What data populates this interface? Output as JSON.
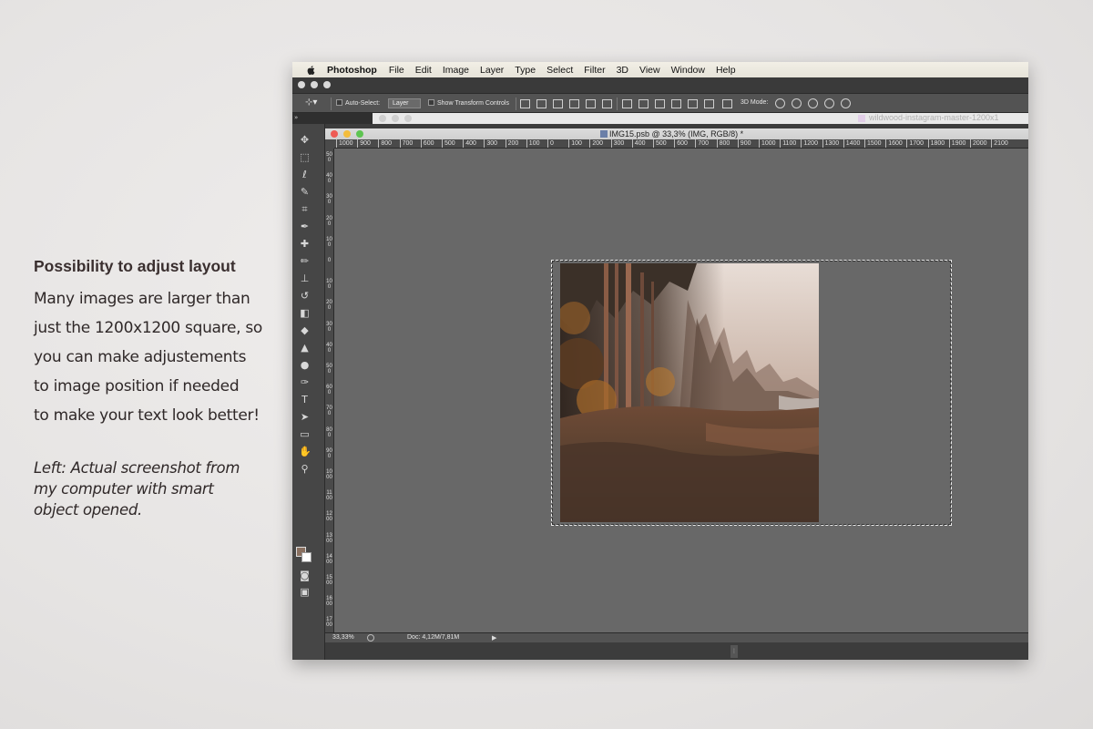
{
  "copy": {
    "heading": "Possibility to adjust layout",
    "paragraph": [
      "Many images are larger than",
      "just the 1200x1200 square, so",
      "you can make adjustements",
      "to image position if needed",
      "to make your text look better!"
    ],
    "note": [
      "Left: Actual screenshot from",
      "my computer with smart",
      "object opened."
    ]
  },
  "menubar": {
    "app_name": "Photoshop",
    "items": [
      "File",
      "Edit",
      "Image",
      "Layer",
      "Type",
      "Select",
      "Filter",
      "3D",
      "View",
      "Window",
      "Help"
    ]
  },
  "options_bar": {
    "auto_select_label": "Auto-Select:",
    "auto_select_value": "Layer",
    "transform_label": "Show Transform Controls",
    "mode_3d_label": "3D Mode:"
  },
  "second_tab": {
    "filename": "wildwood-instagram-master-1200x1"
  },
  "document": {
    "title": "IMG15.psb @ 33,3% (IMG, RGB/8) *",
    "ruler_h": [
      "1000",
      "900",
      "800",
      "700",
      "600",
      "500",
      "400",
      "300",
      "200",
      "100",
      "0",
      "100",
      "200",
      "300",
      "400",
      "500",
      "600",
      "700",
      "800",
      "900",
      "1000",
      "1100",
      "1200",
      "1300",
      "1400",
      "1500",
      "1600",
      "1700",
      "1800",
      "1900",
      "2000",
      "2100"
    ],
    "ruler_v": [
      "500",
      "400",
      "300",
      "200",
      "100",
      "0",
      "100",
      "200",
      "300",
      "400",
      "500",
      "600",
      "700",
      "800",
      "900",
      "1000",
      "1100",
      "1200",
      "1300",
      "1400",
      "1500",
      "1600",
      "1700"
    ]
  },
  "status": {
    "zoom": "33,33%",
    "doc_info": "Doc: 4,12M/7,81M"
  },
  "colors": {
    "foreground": "#8a7060",
    "background": "#ffffff",
    "canvas": "#686868"
  },
  "tool_icons": [
    "move-tool-icon",
    "marquee-tool-icon",
    "lasso-tool-icon",
    "quick-select-tool-icon",
    "crop-tool-icon",
    "eyedropper-tool-icon",
    "healing-tool-icon",
    "brush-tool-icon",
    "stamp-tool-icon",
    "history-brush-tool-icon",
    "eraser-tool-icon",
    "paint-bucket-tool-icon",
    "blur-tool-icon",
    "dodge-tool-icon",
    "pen-tool-icon",
    "type-tool-icon",
    "path-select-tool-icon",
    "shape-tool-icon",
    "hand-tool-icon",
    "zoom-tool-icon"
  ]
}
